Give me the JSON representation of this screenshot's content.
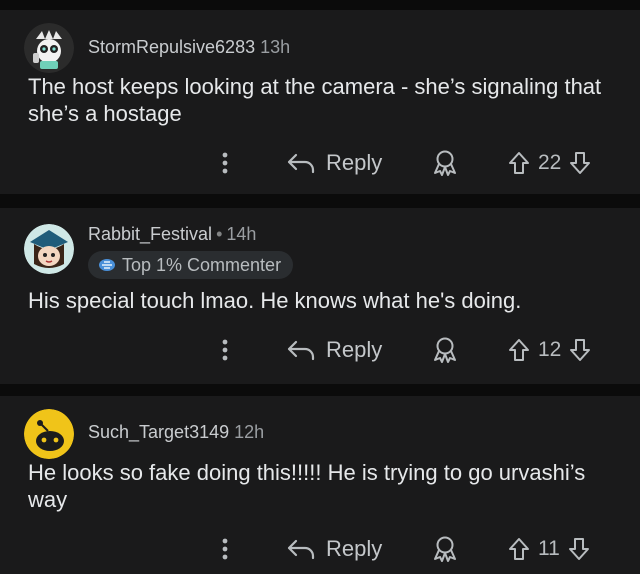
{
  "comments": [
    {
      "username": "StormRepulsive6283",
      "time": "13h",
      "body": "The host keeps looking at the camera - she’s signaling that she’s a hostage",
      "reply_label": "Reply",
      "vote_count": "22",
      "avatar": "snoo-avatar-mint"
    },
    {
      "username": "Rabbit_Festival",
      "time": "14h",
      "badge": "Top 1% Commenter",
      "body": "His special touch lmao. He knows what he's doing.",
      "reply_label": "Reply",
      "vote_count": "12",
      "avatar": "snoo-avatar-hat"
    },
    {
      "username": "Such_Target3149",
      "time": "12h",
      "body": "He looks so fake doing this!!!!! He is trying to go urvashi’s way",
      "reply_label": "Reply",
      "vote_count": "11",
      "avatar": "snoo-avatar-yellow"
    }
  ],
  "icons": {
    "more": "more-vertical-icon",
    "reply": "reply-arrow-icon",
    "award": "award-icon",
    "upvote": "upvote-arrow-icon",
    "downvote": "downvote-arrow-icon"
  },
  "colors": {
    "background": "#0b0b0b",
    "card": "#1a1a1b",
    "text": "#e6e8ea",
    "muted": "#b8bcbf",
    "badge_bg": "#2a2d30",
    "yellow_avatar": "#f0c419"
  }
}
